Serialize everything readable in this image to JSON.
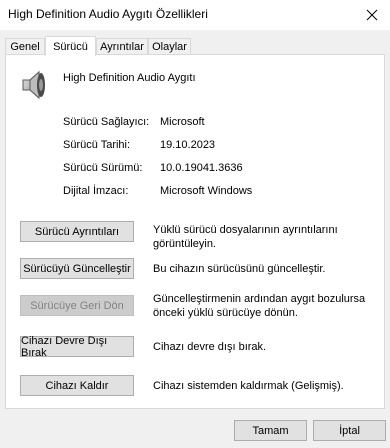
{
  "window": {
    "title": "High Definition Audio Aygıtı Özellikleri",
    "close_icon": "close-icon"
  },
  "tabs": [
    {
      "label": "Genel",
      "active": false
    },
    {
      "label": "Sürücü",
      "active": true
    },
    {
      "label": "Ayrıntılar",
      "active": false
    },
    {
      "label": "Olaylar",
      "active": false
    }
  ],
  "device": {
    "icon": "speaker-icon",
    "name": "High Definition Audio Aygıtı"
  },
  "info": {
    "provider_label": "Sürücü Sağlayıcı:",
    "provider_value": "Microsoft",
    "date_label": "Sürücü Tarihi:",
    "date_value": "19.10.2023",
    "version_label": "Sürücü Sürümü:",
    "version_value": "10.0.19041.3636",
    "signer_label": "Dijital İmzacı:",
    "signer_value": "Microsoft Windows"
  },
  "actions": {
    "details_label": "Sürücü Ayrıntıları",
    "details_desc": "Yüklü sürücü dosyalarının ayrıntılarını görüntüleyin.",
    "update_label": "Sürücüyü Güncelleştir",
    "update_desc": "Bu cihazın sürücüsünü güncelleştir.",
    "rollback_label": "Sürücüye Geri Dön",
    "rollback_desc": "Güncelleştirmenin ardından aygıt bozulursa önceki yüklü sürücüye dönün.",
    "disable_label": "Cihazı Devre Dışı Bırak",
    "disable_desc": "Cihazı devre dışı bırak.",
    "uninstall_label": "Cihazı Kaldır",
    "uninstall_desc": "Cihazı sistemden kaldırmak (Gelişmiş)."
  },
  "footer": {
    "ok_label": "Tamam",
    "cancel_label": "İptal"
  }
}
